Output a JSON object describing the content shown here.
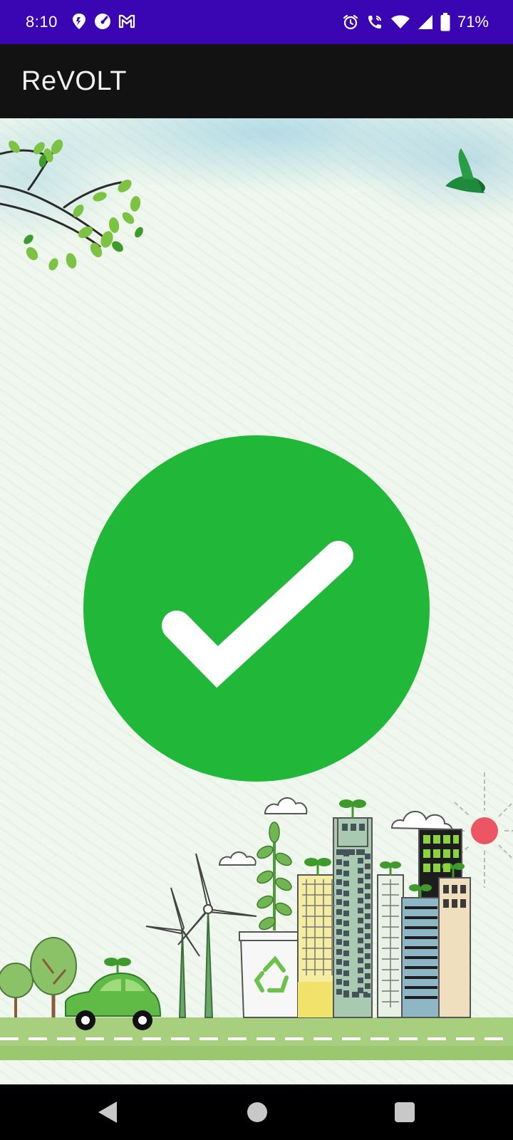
{
  "status_bar": {
    "time": "8:10",
    "battery_percent": "71%",
    "left_icons": [
      "pin-icon",
      "speedometer-icon",
      "gmail-icon"
    ],
    "right_icons": [
      "alarm-icon",
      "wifi-calling-icon",
      "wifi-icon",
      "signal-icon",
      "battery-icon"
    ]
  },
  "app_bar": {
    "title": "ReVOLT"
  },
  "main": {
    "success_icon": "check-circle-icon",
    "success_color": "#21b83a",
    "illustration": "eco-city-illustration"
  },
  "nav_bar": {
    "buttons": [
      "back-button",
      "home-button",
      "recents-button"
    ]
  },
  "colors": {
    "status_bar": "#3a06b4",
    "app_bar": "#121212",
    "background": "#eff7ee",
    "nav_bar": "#000000"
  }
}
